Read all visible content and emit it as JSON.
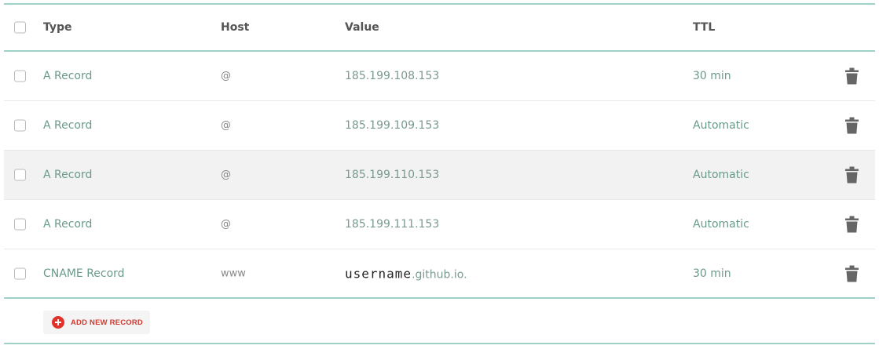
{
  "header": {
    "type": "Type",
    "host": "Host",
    "value": "Value",
    "ttl": "TTL"
  },
  "records": [
    {
      "type": "A Record",
      "host": "@",
      "value": "185.199.108.153",
      "ttl": "30 min"
    },
    {
      "type": "A Record",
      "host": "@",
      "value": "185.199.109.153",
      "ttl": "Automatic"
    },
    {
      "type": "A Record",
      "host": "@",
      "value": "185.199.110.153",
      "ttl": "Automatic"
    },
    {
      "type": "A Record",
      "host": "@",
      "value": "185.199.111.153",
      "ttl": "Automatic"
    },
    {
      "type": "CNAME Record",
      "host": "www",
      "value_username": "username",
      "value_suffix": ".github.io.",
      "ttl": "30 min"
    }
  ],
  "add_button": {
    "label": "ADD NEW RECORD"
  },
  "icons": {
    "delete": "trash-icon",
    "add": "plus-circle-icon",
    "checkbox": "checkbox"
  },
  "colors": {
    "accent_border": "#9fd1c9",
    "add_icon": "#e0322b",
    "highlight_row": "#f2f2f2"
  }
}
